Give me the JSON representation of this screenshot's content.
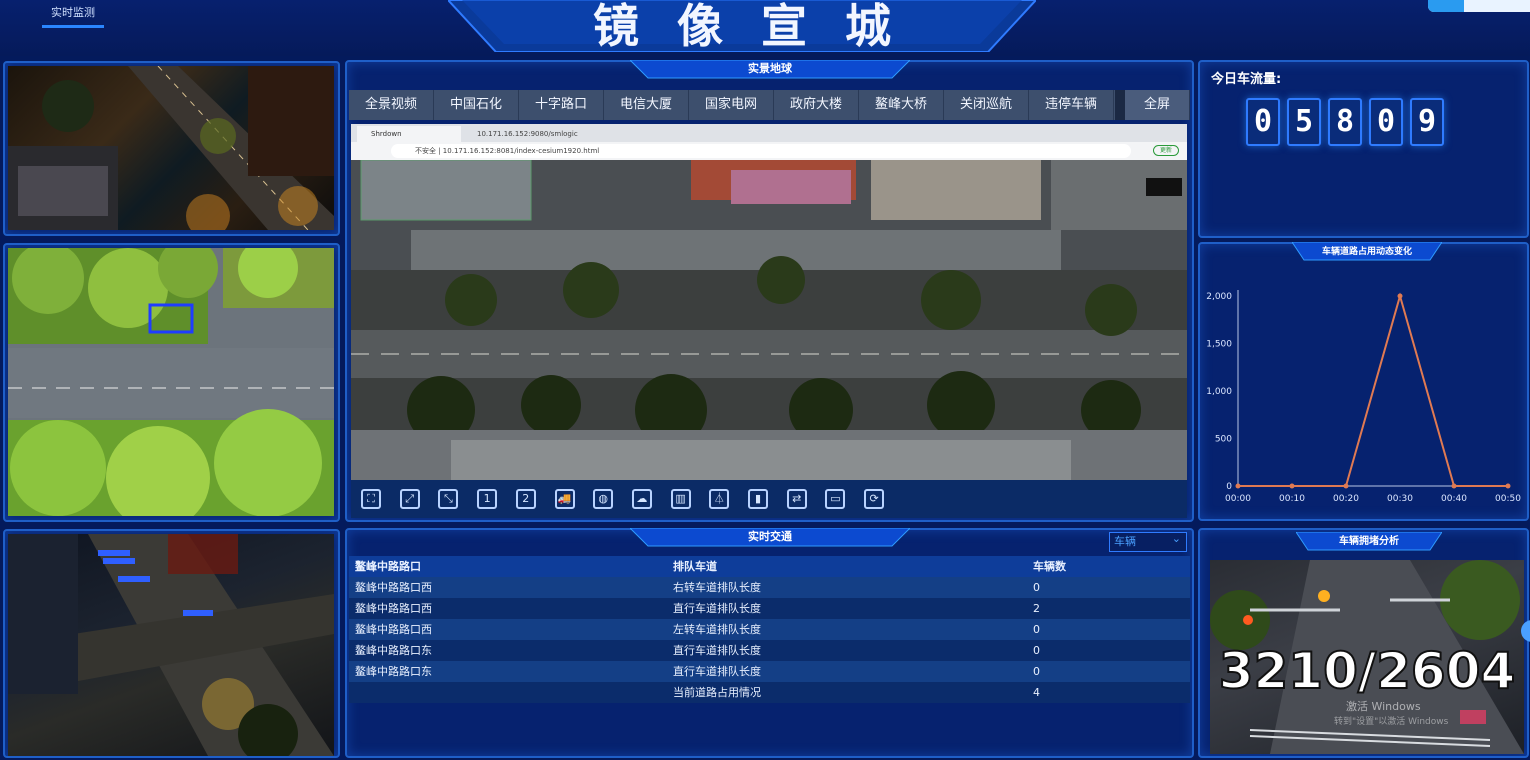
{
  "app": {
    "title": "镜像宣城",
    "nav_tab": "实时监测"
  },
  "panels": {
    "map_title": "实景地球",
    "traffic_title": "实时交通",
    "occupancy_title": "车辆道路占用动态变化",
    "congestion_title": "车辆拥堵分析"
  },
  "nav_tabs": [
    "全景视频",
    "中国石化",
    "十字路口",
    "电信大厦",
    "国家电网",
    "政府大楼",
    "鳌峰大桥",
    "关闭巡航",
    "违停车辆"
  ],
  "fullscreen_label": "全屏",
  "browser": {
    "tab1": "Shrdown",
    "tab2": "10.171.16.152:9080/smlogic",
    "address": "不安全 | 10.171.16.152:8081/index-cesium1920.html",
    "badge": "更新"
  },
  "toolbar_icons": [
    "fullscreen-icon",
    "expand-icon",
    "collapse-icon",
    "view-1-icon",
    "view-2-icon",
    "vehicle-icon",
    "globe-icon",
    "cloud-icon",
    "building-icon",
    "flask-icon",
    "bar-chart-icon",
    "car-icon",
    "window-icon",
    "refresh-icon"
  ],
  "toolbar_labels": [
    "⛶",
    "⤢",
    "⤡",
    "1",
    "2",
    "🚚",
    "◍",
    "☁",
    "▥",
    "⏃",
    "▮",
    "⇄",
    "▭",
    "⟳"
  ],
  "traffic_flow": {
    "label": "今日车流量:",
    "digits": [
      "0",
      "5",
      "8",
      "0",
      "9"
    ]
  },
  "occupancy_chart": {
    "y_ticks": [
      "2,000",
      "1,500",
      "1,000",
      "500",
      "0"
    ],
    "x_ticks": [
      "00:00",
      "00:10",
      "00:20",
      "00:30",
      "00:40",
      "00:50"
    ]
  },
  "chart_data": {
    "type": "line",
    "title": "车辆道路占用动态变化",
    "x": [
      "00:00",
      "00:10",
      "00:20",
      "00:30",
      "00:40",
      "00:50"
    ],
    "series": [
      {
        "values": [
          0,
          0,
          0,
          2000,
          0,
          0
        ]
      }
    ],
    "ylim": [
      0,
      2000
    ],
    "color": "#e07a52",
    "grid": false
  },
  "traffic_table": {
    "select_value": "车辆",
    "headers": [
      "鳌峰中路路口",
      "排队车道",
      "车辆数"
    ],
    "rows": [
      [
        "鳌峰中路路口西",
        "右转车道排队长度",
        "0"
      ],
      [
        "鳌峰中路路口西",
        "直行车道排队长度",
        "2"
      ],
      [
        "鳌峰中路路口西",
        "左转车道排队长度",
        "0"
      ],
      [
        "鳌峰中路路口东",
        "直行车道排队长度",
        "0"
      ],
      [
        "鳌峰中路路口东",
        "直行车道排队长度",
        "0"
      ],
      [
        "",
        "当前道路占用情况",
        "4"
      ]
    ]
  },
  "congestion_feed": {
    "count": "3210/2604",
    "watermark": "激活 Windows",
    "watermark2": "转到\"设置\"以激活 Windows"
  },
  "colors": {
    "bg": "#041a5c",
    "panel_border": "#1f5fc8",
    "accent": "#2f7bff",
    "line": "#e07a52"
  }
}
